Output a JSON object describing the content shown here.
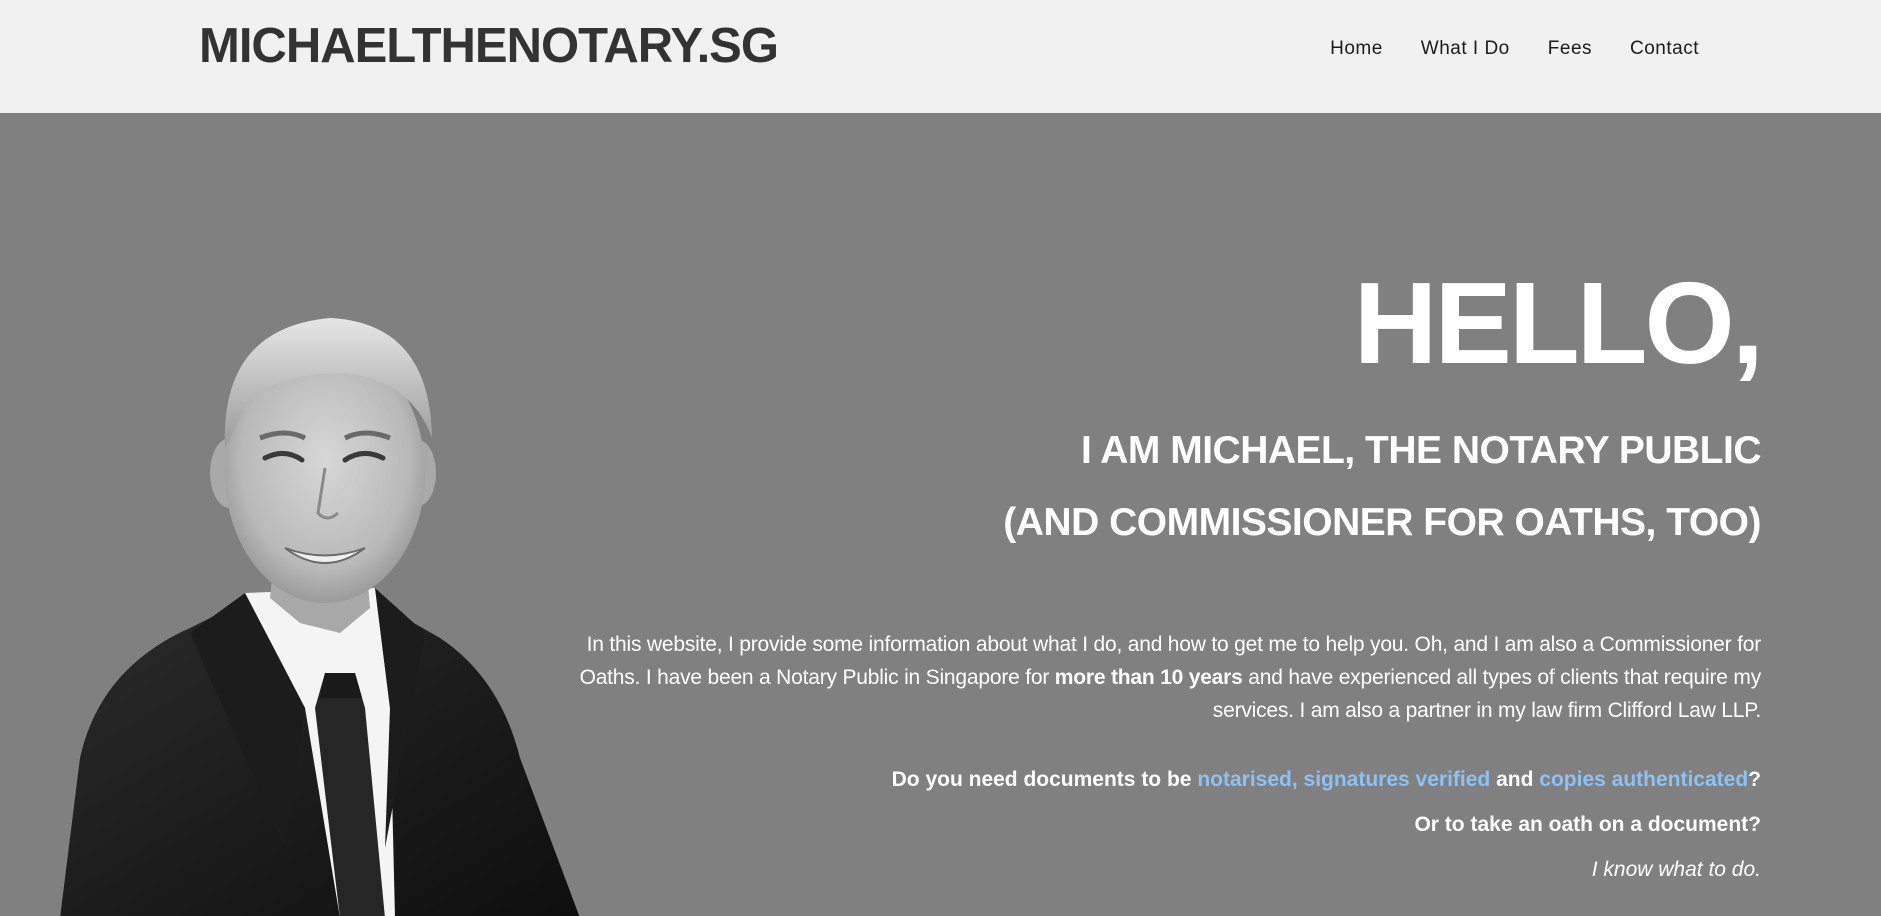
{
  "header": {
    "logo": "MICHAELTHENOTARY.SG",
    "nav": [
      "Home",
      "What I Do",
      "Fees",
      "Contact"
    ]
  },
  "hero": {
    "greeting": "HELLO,",
    "subtitle_line1": "I AM MICHAEL, THE NOTARY PUBLIC",
    "subtitle_line2": "(AND COMMISSIONER FOR OATHS, TOO)",
    "intro_part1": "In this website, I provide some information about what I do, and how to get me to help you. Oh, and I am also a Commissioner for Oaths. I have been a Notary Public in Singapore for ",
    "intro_bold": "more than 10 years",
    "intro_part2": " and have experienced all types of clients that require my services. I am also a partner in my law firm Clifford Law LLP.",
    "question1_prefix": "Do you need documents to be ",
    "question1_link1": "notarised, signatures verified",
    "question1_middle": " and ",
    "question1_link2": "copies authenticated",
    "question1_suffix": "?",
    "question2": "Or to take an oath on a document?",
    "tagline": "I know what to do."
  },
  "colors": {
    "header_bg": "#f1f1f1",
    "hero_bg": "#808080",
    "link": "#8ec1f2",
    "logo_text": "#333333"
  }
}
